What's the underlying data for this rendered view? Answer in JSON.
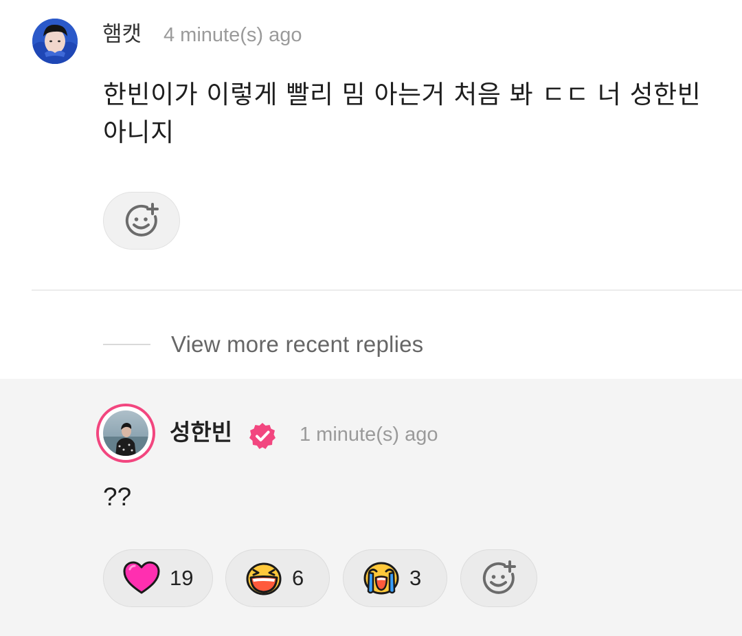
{
  "comment": {
    "author": "햄캣",
    "time": "4 minute(s) ago",
    "body": "한빈이가 이렇게 빨리 밈 아는거 처음 봐 ㄷㄷ 너 성한빈 아니지"
  },
  "view_more": {
    "label": "View more recent replies"
  },
  "reply": {
    "author": "성한빈",
    "verified": true,
    "time": "1 minute(s) ago",
    "body": "??",
    "reactions": [
      {
        "icon": "heart-icon",
        "count": "19",
        "color": "#ff2fb0"
      },
      {
        "icon": "laughing-face-icon",
        "count": "6",
        "color": "#ffc83a"
      },
      {
        "icon": "crying-face-icon",
        "count": "3",
        "color": "#ffc83a"
      }
    ]
  },
  "colors": {
    "accent": "#f2467f",
    "reply_background": "#f4f4f4",
    "muted_text": "#9a9a9a"
  }
}
